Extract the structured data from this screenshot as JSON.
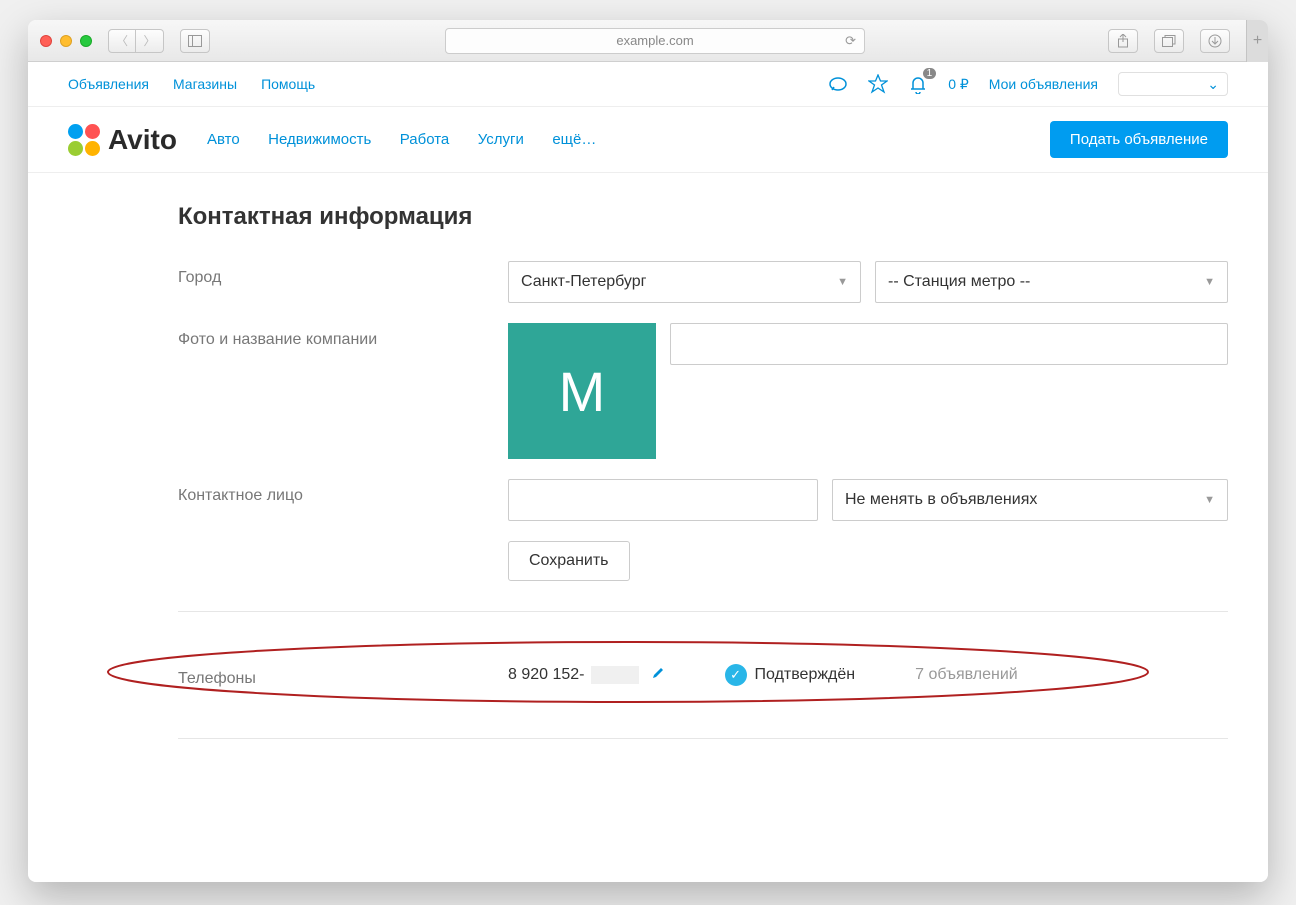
{
  "browser": {
    "url": "example.com"
  },
  "topbar": {
    "links": [
      "Объявления",
      "Магазины",
      "Помощь"
    ],
    "notifications": "1",
    "balance": "0 ₽",
    "my_ads": "Мои объявления"
  },
  "logo_text": "Avito",
  "mainnav": {
    "items": [
      "Авто",
      "Недвижимость",
      "Работа",
      "Услуги",
      "ещё…"
    ]
  },
  "post_button": "Подать объявление",
  "section": {
    "title": "Контактная информация",
    "labels": {
      "city": "Город",
      "company": "Фото и название компании",
      "contact": "Контактное лицо",
      "phones": "Телефоны"
    },
    "city_value": "Санкт-Петербург",
    "metro_placeholder": "-- Станция метро --",
    "company_letter": "М",
    "contact_option": "Не менять в объявлениях",
    "save": "Сохранить"
  },
  "phone": {
    "number": "8 920 152-",
    "verified": "Подтверждён",
    "ads": "7 объявлений"
  }
}
